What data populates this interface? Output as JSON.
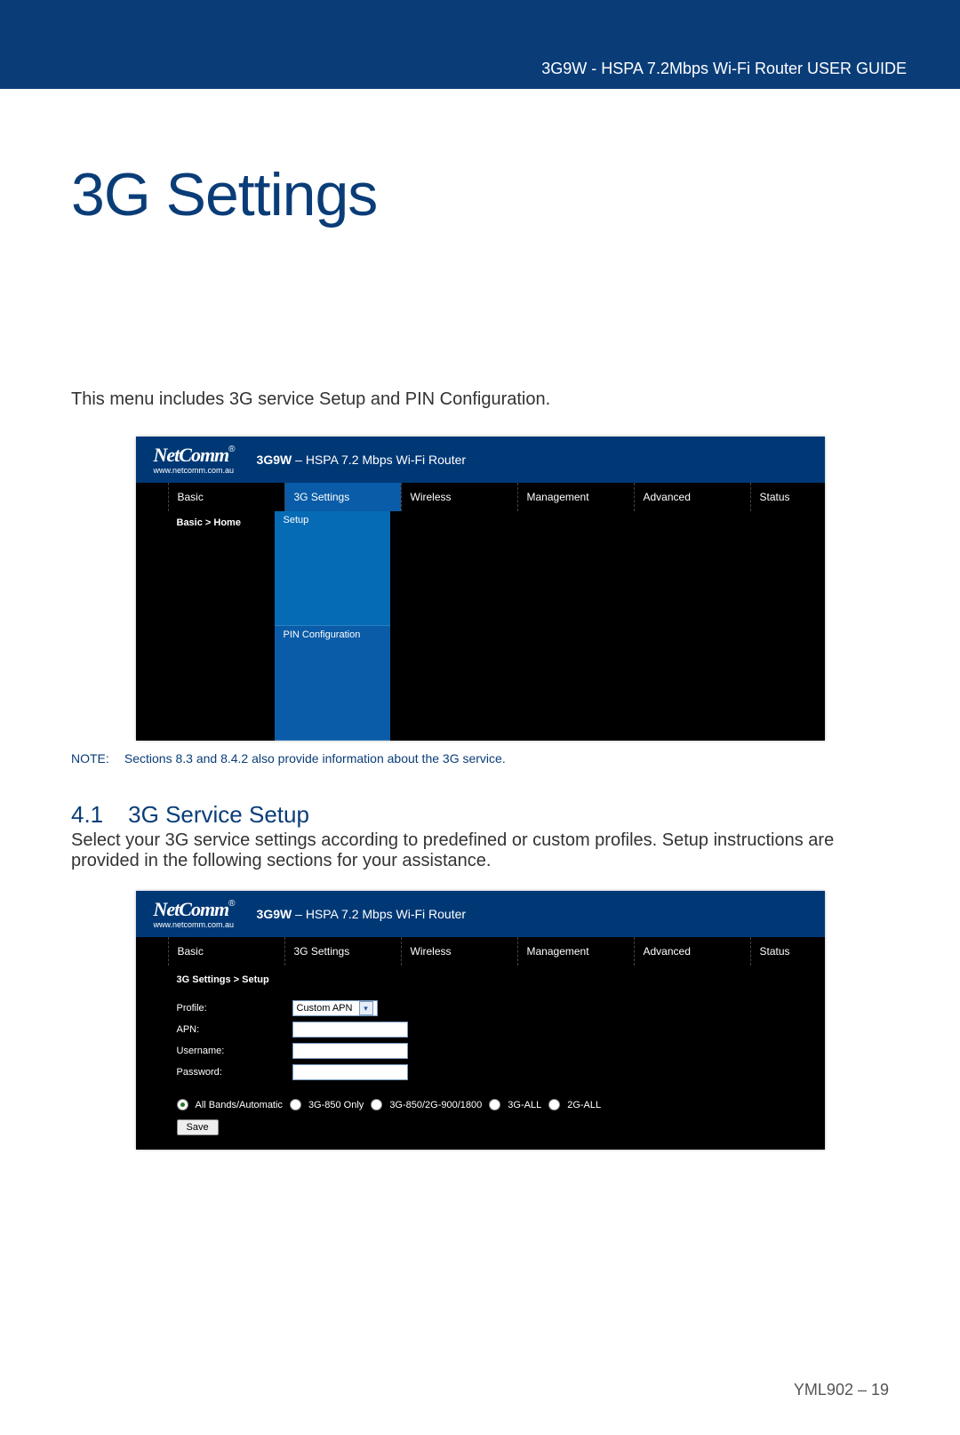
{
  "header": {
    "doc_title": "3G9W - HSPA 7.2Mbps Wi-Fi Router USER GUIDE"
  },
  "chapter": {
    "title": "3G Settings"
  },
  "intro": "This menu includes 3G service Setup and PIN Configuration.",
  "logo": {
    "brand": "NetComm",
    "reg": "®",
    "url": "www.netcomm.com.au"
  },
  "router_label": {
    "model": "3G9W",
    "dash": " – ",
    "desc": "HSPA 7.2 Mbps Wi-Fi Router"
  },
  "nav": {
    "items": [
      "Basic",
      "3G Settings",
      "Wireless",
      "Management",
      "Advanced",
      "Status"
    ]
  },
  "shot1": {
    "breadcrumb": "Basic > Home",
    "sub1": "Setup",
    "sub2": "PIN Configuration"
  },
  "note": {
    "label": "NOTE:",
    "text": "Sections 8.3 and 8.4.2 also provide information about the 3G service."
  },
  "section": {
    "num": "4.1",
    "title": "3G Service Setup",
    "body": "Select your 3G service settings according to predefined or custom profiles. Setup instructions are provided in the following sections for your assistance."
  },
  "shot2": {
    "breadcrumb": "3G Settings > Setup",
    "fields": {
      "profile_label": "Profile:",
      "profile_value": "Custom APN",
      "apn_label": "APN:",
      "apn_value": "",
      "user_label": "Username:",
      "user_value": "",
      "pass_label": "Password:",
      "pass_value": ""
    },
    "bands": [
      "All Bands/Automatic",
      "3G-850 Only",
      "3G-850/2G-900/1800",
      "3G-ALL",
      "2G-ALL"
    ],
    "selected_band_index": 0,
    "save": "Save"
  },
  "footer": "YML902 – 19"
}
